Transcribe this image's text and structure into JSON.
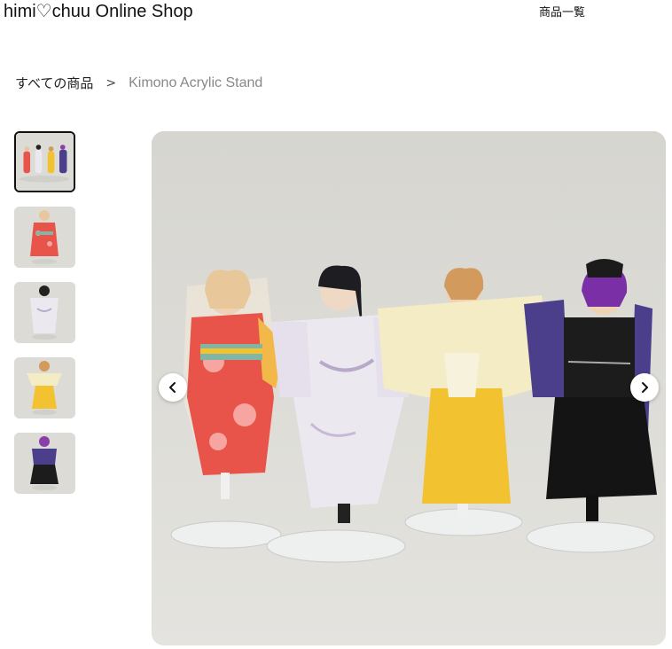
{
  "header": {
    "shop_title": "himi♡chuu Online Shop",
    "nav_label": "商品一覧"
  },
  "breadcrumb": {
    "root": "すべての商品",
    "separator": ">",
    "current": "Kimono Acrylic Stand"
  },
  "gallery": {
    "thumbnail_count": 5,
    "active_index": 0,
    "prev_icon": "chevron-left-icon",
    "next_icon": "chevron-right-icon"
  },
  "colors": {
    "background": "#dcdbd6",
    "kimono_red": "#e8544a",
    "kimono_white": "#ece8ef",
    "hakama_yellow": "#f2c230",
    "kimono_purple": "#4b3f8c"
  }
}
